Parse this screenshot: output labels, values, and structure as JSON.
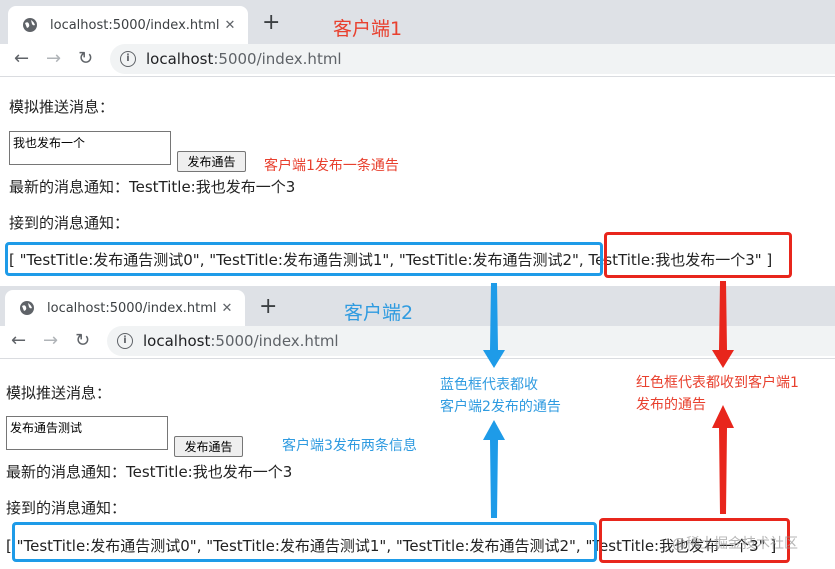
{
  "client1": {
    "tab_title": "localhost:5000/index.html",
    "label": "客户端1",
    "url_host": "localhost",
    "url_path": ":5000/index.html",
    "heading": "模拟推送消息：",
    "textarea_value": "我也发布一个",
    "button_label": "发布通告",
    "latest_label": "最新的消息通知：TestTitle:我也发布一个3",
    "received_heading": "接到的消息通知：",
    "received_list": "[ \"TestTitle:发布通告测试0\", \"TestTitle:发布通告测试1\", \"TestTitle:发布通告测试2\",  TestTitle:我也发布一个3\" ]",
    "annotation": "客户端1发布一条通告"
  },
  "client2": {
    "tab_title": "localhost:5000/index.html",
    "label": "客户端2",
    "url_host": "localhost",
    "url_path": ":5000/index.html",
    "heading": "模拟推送消息：",
    "textarea_value": "发布通告测试",
    "button_label": "发布通告",
    "latest_label": "最新的消息通知：TestTitle:我也发布一个3",
    "received_heading": "接到的消息通知：",
    "received_list": "[ \"TestTitle:发布通告测试0\", \"TestTitle:发布通告测试1\", \"TestTitle:发布通告测试2\", \"TestTitle:我也发布一个3\" ]",
    "annotation": "客户端3发布两条信息"
  },
  "annotations": {
    "blue_note_line1": "蓝色框代表都收",
    "blue_note_line2": "客户端2发布的通告",
    "red_note_line1": "红色框代表都收到客户端1",
    "red_note_line2": "发布的通告"
  },
  "watermark": "@稀土掘金技术社区",
  "colors": {
    "annotation_red": "#e8402e",
    "annotation_blue": "#2f9be0",
    "box_blue": "#1e9be8",
    "box_red": "#e8261c",
    "tabbar_bg": "#dee1e6"
  },
  "icons": {
    "tab_favicon": "globe-icon",
    "back": "arrow-left-icon",
    "forward": "arrow-right-icon",
    "reload": "reload-icon",
    "site_info": "info-icon",
    "close_tab": "close-icon",
    "new_tab": "plus-icon"
  }
}
